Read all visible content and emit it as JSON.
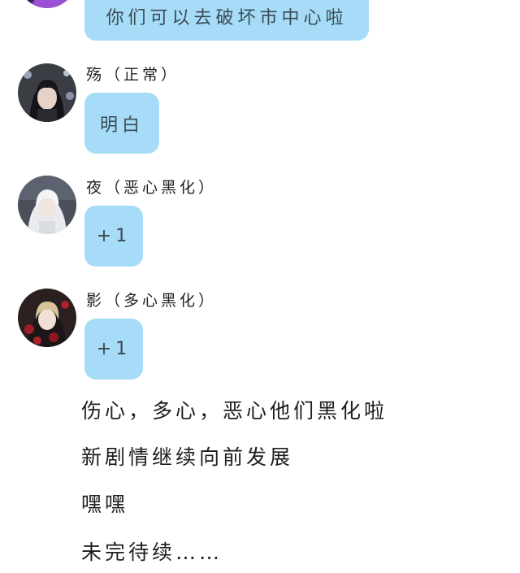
{
  "chat": {
    "top_message": {
      "text": "你们可以去破坏市中心啦"
    },
    "messages": [
      {
        "sender": "殇（正常）",
        "text": "明白",
        "avatar_icon": "dark-haired-character-avatar"
      },
      {
        "sender": "夜（恶心黑化）",
        "text": "+1",
        "avatar_icon": "white-haired-character-avatar"
      },
      {
        "sender": "影（多心黑化）",
        "text": "+1",
        "avatar_icon": "blonde-character-roses-avatar"
      }
    ],
    "bubble_color": "#a6dcf8"
  },
  "narration": {
    "lines": [
      "伤心，多心，恶心他们黑化啦",
      "新剧情继续向前发展",
      "嘿嘿",
      "未完待续……"
    ]
  }
}
